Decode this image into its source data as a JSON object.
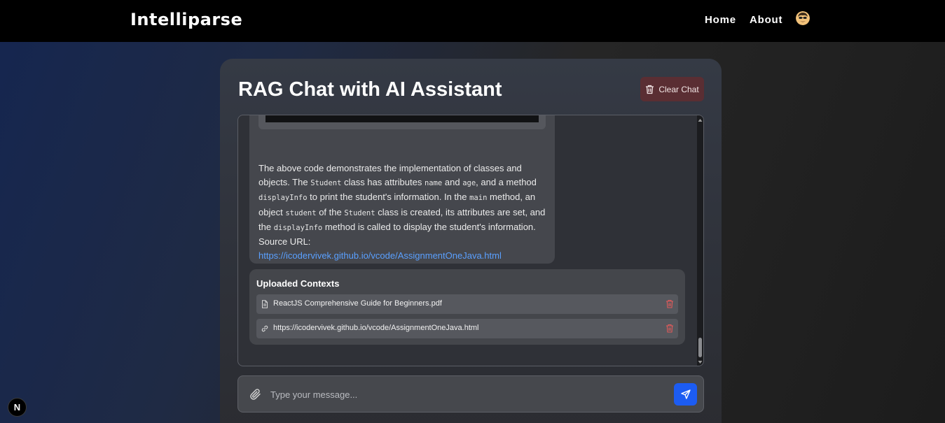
{
  "navbar": {
    "brand": "Intelliparse",
    "links": [
      {
        "label": "Home"
      },
      {
        "label": "About"
      }
    ]
  },
  "chat": {
    "title": "RAG Chat with AI Assistant",
    "clear_label": "Clear Chat",
    "message": {
      "segments": [
        {
          "text": "The above code demonstrates the implementation of classes and objects. The ",
          "code": false
        },
        {
          "text": "Student",
          "code": true
        },
        {
          "text": " class has attributes ",
          "code": false
        },
        {
          "text": "name",
          "code": true
        },
        {
          "text": " and ",
          "code": false
        },
        {
          "text": "age",
          "code": true
        },
        {
          "text": ", and a method ",
          "code": false
        },
        {
          "text": "displayInfo",
          "code": true
        },
        {
          "text": " to print the student's information. In the ",
          "code": false
        },
        {
          "text": "main",
          "code": true
        },
        {
          "text": " method, an object ",
          "code": false
        },
        {
          "text": "student",
          "code": true
        },
        {
          "text": " of the ",
          "code": false
        },
        {
          "text": "Student",
          "code": true
        },
        {
          "text": " class is created, its attributes are set, and the ",
          "code": false
        },
        {
          "text": "displayInfo",
          "code": true
        },
        {
          "text": " method is called to display the student's information.",
          "code": false
        }
      ],
      "source_label": "Source URL:",
      "source_url": "https://icodervivek.github.io/vcode/AssignmentOneJava.html"
    },
    "contexts": {
      "title": "Uploaded Contexts",
      "items": [
        {
          "icon": "file-icon",
          "label": "ReactJS Comprehensive Guide for Beginners.pdf"
        },
        {
          "icon": "link-icon",
          "label": "https://icodervivek.github.io/vcode/AssignmentOneJava.html"
        }
      ]
    },
    "input": {
      "placeholder": "Type your message...",
      "value": ""
    }
  },
  "badge": {
    "label": "N"
  },
  "colors": {
    "navbar_bg": "#000000",
    "send_button": "#1c5cf2",
    "clear_button": "#5a2e33",
    "link": "#5aa0ff",
    "delete_icon": "#e05a5a"
  }
}
